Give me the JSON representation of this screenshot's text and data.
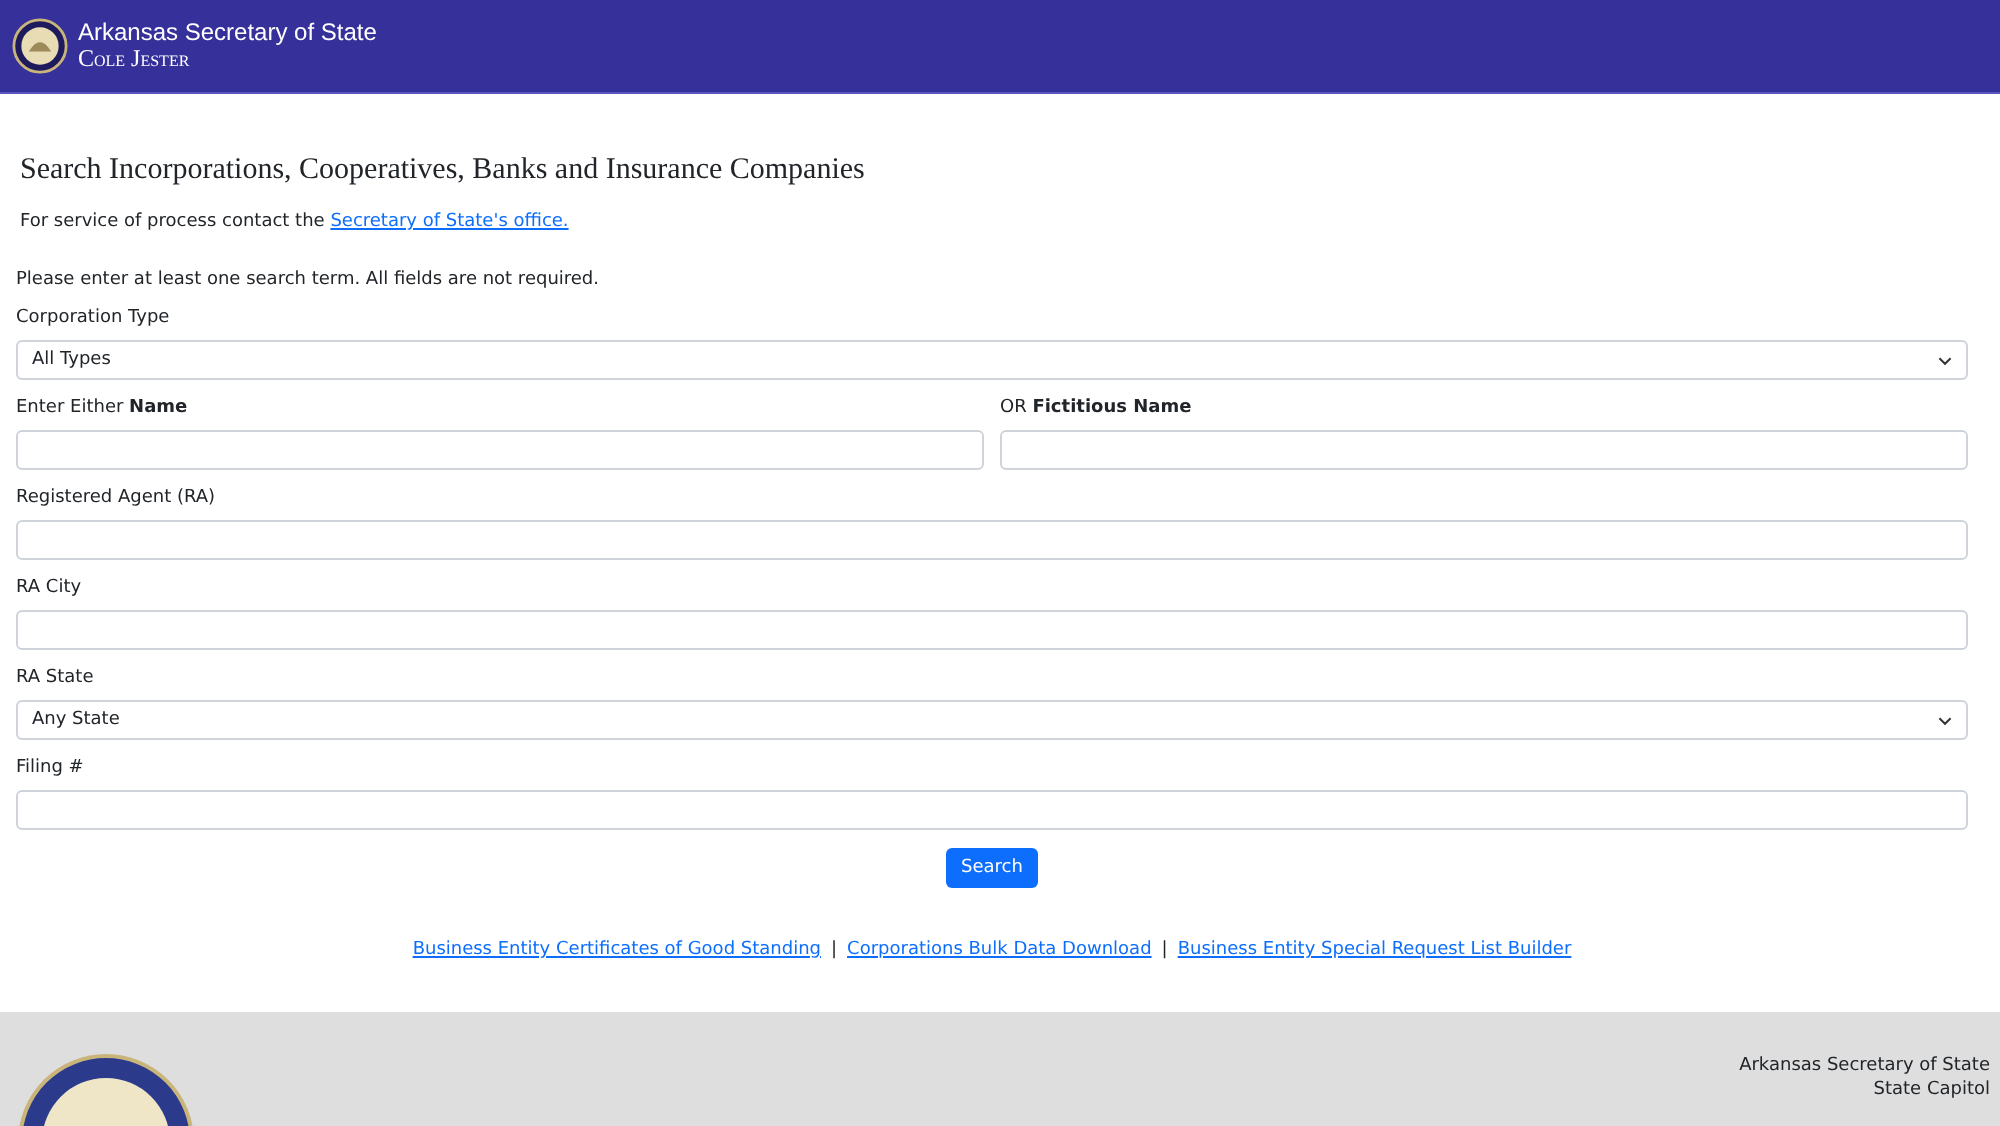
{
  "header": {
    "title": "Arkansas Secretary of State",
    "subtitle": "Cole Jester"
  },
  "page_title": "Search Incorporations, Cooperatives, Banks and Insurance Companies",
  "service_note": {
    "text": "For service of process contact the ",
    "link": "Secretary of State's office."
  },
  "instructions": "Please enter at least one search term. All fields are not required.",
  "fields": [
    {
      "kind": "select",
      "label": "Corporation Type",
      "value": "All Types"
    },
    {
      "kind": "pair",
      "items": [
        {
          "label": "Enter Either **Name**"
        },
        {
          "label": "OR **Fictitious Name**"
        }
      ]
    },
    {
      "kind": "text",
      "label": "Registered Agent (RA)"
    },
    {
      "kind": "text",
      "label": "RA City"
    },
    {
      "kind": "select",
      "label": "RA State",
      "value": "Any State"
    },
    {
      "kind": "text",
      "label": "Filing #"
    }
  ],
  "search_button": "Search",
  "links": [
    "Business Entity Certificates of Good Standing",
    "Corporations Bulk Data Download",
    "Business Entity Special Request List Builder"
  ],
  "link_separator": "|",
  "footer": {
    "lines": [
      "Arkansas Secretary of State",
      "State Capitol"
    ]
  }
}
